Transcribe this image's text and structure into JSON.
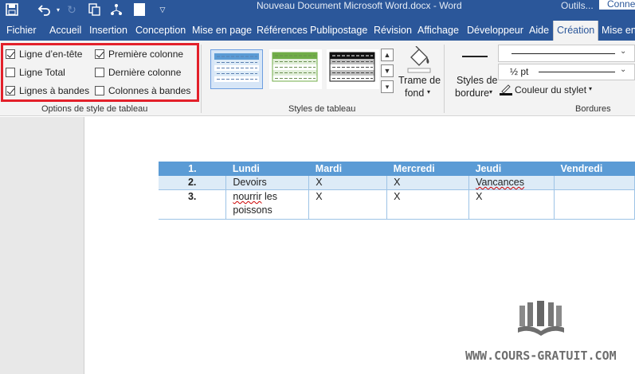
{
  "window": {
    "title": "Nouveau Document Microsoft Word.docx - Word",
    "context_tab_group": "Outils...",
    "account_label": "Conne"
  },
  "tabs": [
    "Fichier",
    "Accueil",
    "Insertion",
    "Conception",
    "Mise en page",
    "Références",
    "Publipostage",
    "Révision",
    "Affichage",
    "Développeur",
    "Aide",
    "Création",
    "Mise en"
  ],
  "active_tab": "Création",
  "ribbon": {
    "table_style_options": {
      "group_label": "Options de style de tableau",
      "options": [
        {
          "label": "Ligne d’en-tête",
          "checked": true
        },
        {
          "label": "Ligne Total",
          "checked": false
        },
        {
          "label": "Lignes à bandes",
          "checked": true
        },
        {
          "label": "Première colonne",
          "checked": true
        },
        {
          "label": "Dernière colonne",
          "checked": false
        },
        {
          "label": "Colonnes à bandes",
          "checked": false
        }
      ]
    },
    "table_styles": {
      "group_label": "Styles de tableau",
      "shading_label_line1": "Trame de",
      "shading_label_line2": "fond"
    },
    "borders": {
      "group_label": "Bordures",
      "border_styles_line1": "Styles de",
      "border_styles_line2": "bordure",
      "pen_weight": "½ pt",
      "pen_color_label": "Couleur du stylet"
    }
  },
  "table": {
    "headers": [
      "1.",
      "Lundi",
      "Mardi",
      "Mercredi",
      "Jeudi",
      "Vendredi"
    ],
    "rows": [
      {
        "num": "2.",
        "cells": [
          "Devoirs",
          "X",
          "X",
          "Vancances",
          ""
        ]
      },
      {
        "num": "3.",
        "cells": [
          "nourrir les poissons",
          "X",
          "X",
          "X",
          ""
        ]
      }
    ]
  },
  "colors": {
    "title_bar": "#2b579a",
    "table_header": "#5b9bd5",
    "table_band": "#ddebf7",
    "highlight_box": "#e3202a"
  },
  "watermark": {
    "text": "WWW.COURS-GRATUIT.COM"
  }
}
